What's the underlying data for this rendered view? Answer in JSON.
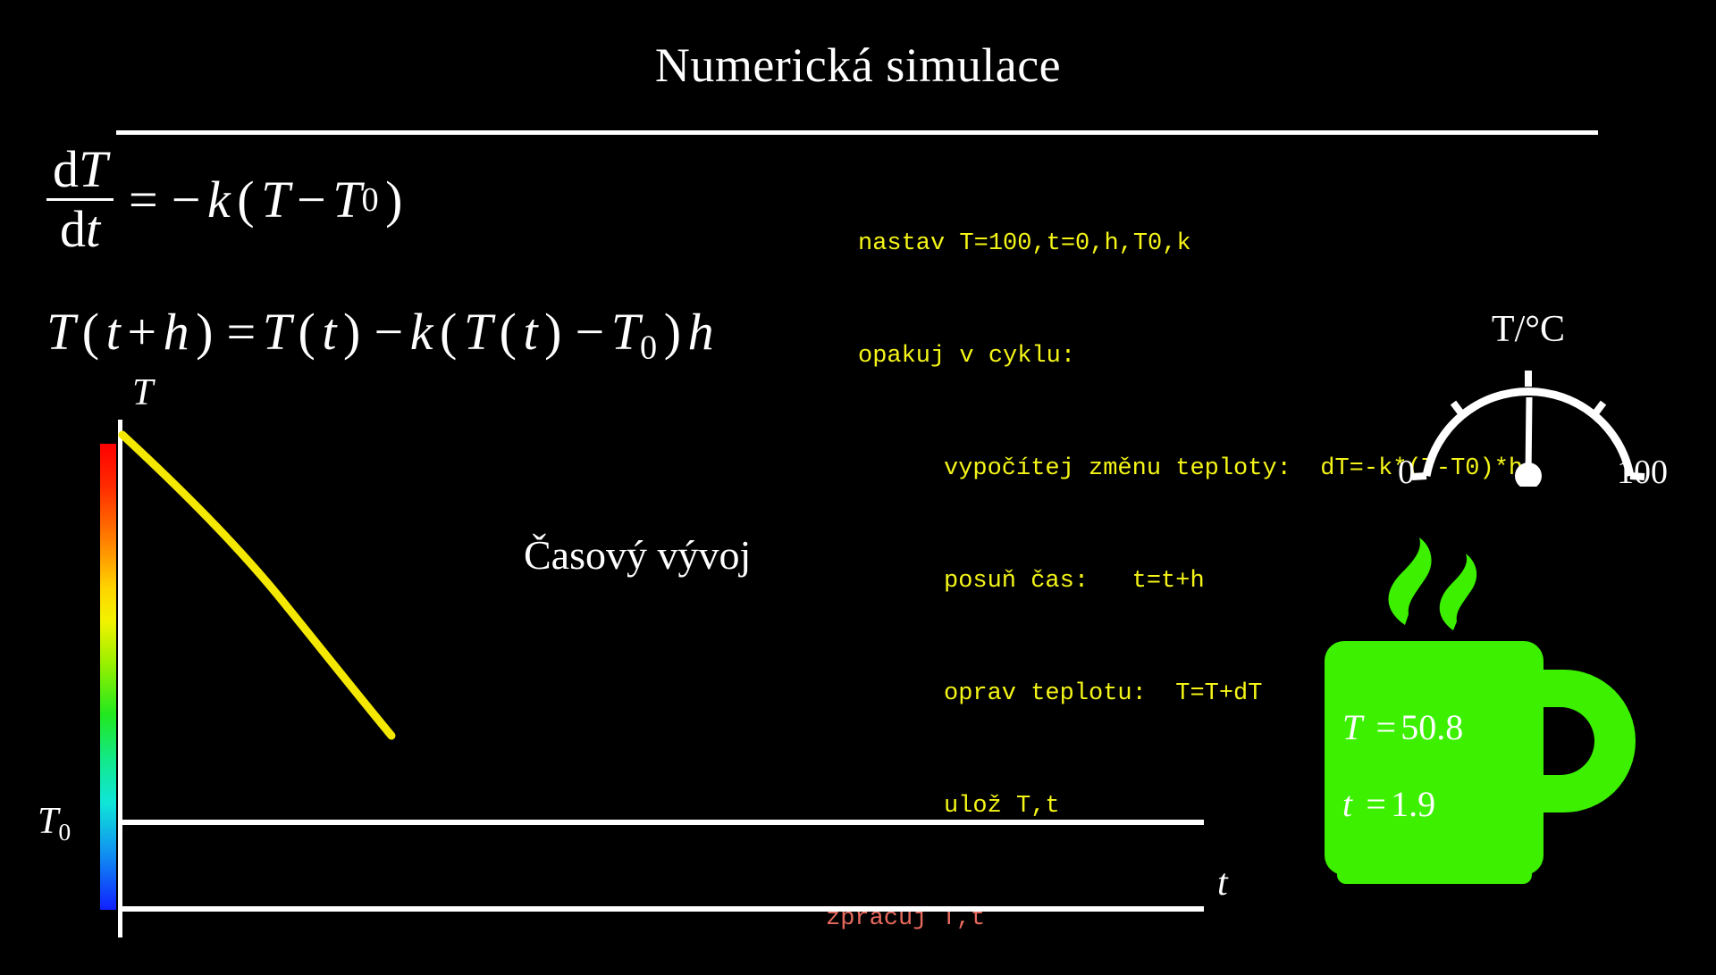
{
  "slide": {
    "title": "Numerická simulace",
    "background_color": "#000000",
    "text_color": "#ffffff"
  },
  "equations": {
    "ode": {
      "numerator": "d",
      "numerator_var": "T",
      "denominator": "d",
      "denominator_var": "t",
      "equals": "=",
      "rhs_minus": "−",
      "rhs_k": "k",
      "open_paren": "(",
      "var_T": "T",
      "minus": "−",
      "var_T0": "T",
      "sub_zero": "0",
      "close_paren": ")"
    },
    "euler": "T(t + h) = T(t) − k(T(t) − T₀)h",
    "euler_parts": {
      "T1": "T",
      "op1": "(",
      "t1": "t",
      "plus": "+",
      "h1": "h",
      "cp1": ")",
      "eq": "=",
      "T2": "T",
      "op2": "(",
      "t2": "t",
      "cp2": ")",
      "minus1": "−",
      "k": "k",
      "op3": "(",
      "T3": "T",
      "op4": "(",
      "t3": "t",
      "cp4": ")",
      "minus2": "−",
      "T4": "T",
      "zero": "0",
      "cp3": ")",
      "h2": "h"
    }
  },
  "pseudocode": {
    "color_primary": "#f5f518",
    "color_accent": "#e8695e",
    "lines": [
      {
        "indent": 0,
        "color": "primary",
        "text": "nastav T=100,t=0,h,T0,k"
      },
      {
        "indent": 0,
        "color": "primary",
        "text": "opakuj v cyklu:"
      },
      {
        "indent": 1,
        "color": "primary",
        "text": "vypočítej změnu teploty:  dT=-k*(T-T0)*h"
      },
      {
        "indent": 1,
        "color": "primary",
        "text": "posuň čas:   t=t+h"
      },
      {
        "indent": 1,
        "color": "primary",
        "text": "oprav teplotu:  T=T+dT"
      },
      {
        "indent": 1,
        "color": "primary",
        "text": "ulož T,t"
      },
      {
        "indent": -1,
        "color": "accent",
        "text": "zpracuj T,t"
      }
    ]
  },
  "chart_data": {
    "type": "line",
    "title": "Časový vývoj",
    "xlabel": "t",
    "ylabel": "T",
    "series": [
      {
        "name": "T(t)",
        "color": "#f5e800",
        "x": [
          0.0,
          0.1,
          0.2,
          0.3,
          0.4,
          0.5,
          0.6,
          0.7,
          0.8,
          0.9,
          1.0
        ],
        "y": [
          100.0,
          91.4,
          83.6,
          76.6,
          70.4,
          64.8,
          59.8,
          55.3,
          51.4,
          47.8,
          44.6
        ]
      }
    ],
    "reference_lines": [
      {
        "name": "T0",
        "label": "T₀",
        "orientation": "horizontal",
        "value": 20,
        "color": "#ffffff"
      }
    ],
    "axis_labels": {
      "y": "T",
      "y_origin": "T₀",
      "x": "t"
    },
    "colorbar": {
      "present": true,
      "orientation": "vertical",
      "top_color": "#ff0000",
      "bottom_color": "#1020ff",
      "stops": [
        "#ff0000",
        "#ff7a00",
        "#f2f200",
        "#22e81e",
        "#10e6d8",
        "#1020ff"
      ]
    },
    "grid": false,
    "legend": "none"
  },
  "gauge": {
    "title": "T/°C",
    "min_label": "0",
    "max_label": "100",
    "min_value": 0,
    "max_value": 100,
    "value": 50.8,
    "tick_count": 5,
    "color": "#ffffff"
  },
  "mug": {
    "color": "#3cf000",
    "text_color": "#000000",
    "readout": [
      {
        "symbol": "T",
        "equals": "=",
        "value": "50.8"
      },
      {
        "symbol": "t",
        "equals": "=",
        "value": "1.9"
      }
    ],
    "steam_curls": 2
  }
}
